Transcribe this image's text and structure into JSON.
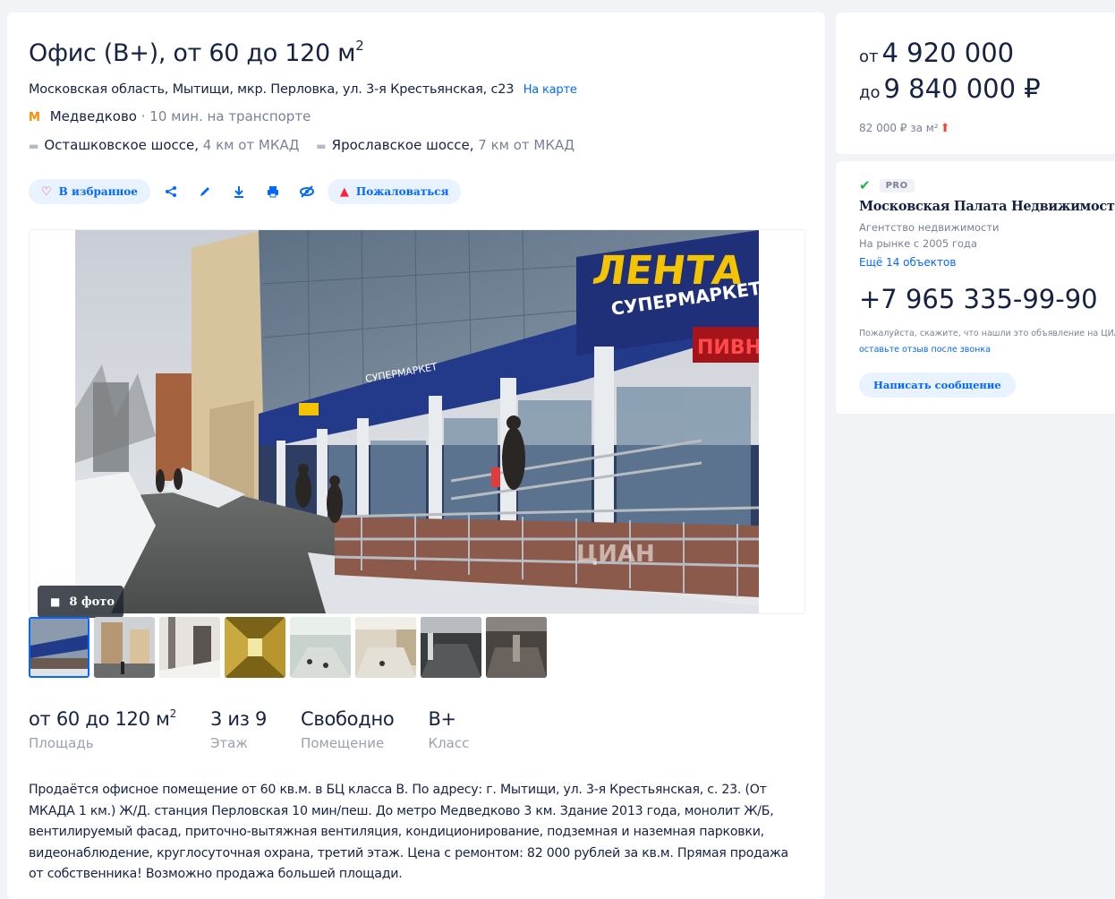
{
  "listing": {
    "title": "Офис (В+), от 60 до 120 м",
    "title_sup": "2",
    "address": "Московская область, Мытищи, мкр. Перловка, ул. 3-я Крестьянская, с23",
    "map_link": "На карте",
    "metro": {
      "icon": "metro-m-icon",
      "station": "Медведково",
      "time": "· 10 мин. на транспорте"
    },
    "highways": [
      {
        "name": "Осташковское шоссе,",
        "dist": "4 км от МКАД"
      },
      {
        "name": "Ярославское шоссе,",
        "dist": "7 км от МКАД"
      }
    ]
  },
  "actions": {
    "favorite": "В избранное",
    "report": "Пожаловаться",
    "icons": [
      "share-icon",
      "edit-icon",
      "download-icon",
      "print-icon",
      "hide-icon"
    ]
  },
  "gallery": {
    "photo_count": "8 фото",
    "watermark": "ЦИАН",
    "signs": {
      "store": "ЛЕНТА",
      "supermarket": "СУПЕРМАРКЕТ",
      "beer": "ПИВН"
    },
    "thumbnails": 8
  },
  "facts": [
    {
      "value": "от 60 до 120 м",
      "sup": "2",
      "label": "Площадь"
    },
    {
      "value": "3 из 9",
      "sup": "",
      "label": "Этаж"
    },
    {
      "value": "Свободно",
      "sup": "",
      "label": "Помещение"
    },
    {
      "value": "B+",
      "sup": "",
      "label": "Класс"
    }
  ],
  "description": "Продаётся офисное помещение от 60 кв.м. в БЦ класса В. По адресу: г. Мытищи, ул. 3-я Крестьянская, с. 23. (От МКАДА 1 км.) Ж/Д. станция Перловская 10 мин/пеш. До метро Медведково 3 км. Здание 2013 года, монолит Ж/Б, вентилируемый фасад, приточно-вытяжная вентиляция, кондиционирование, подземная и наземная парковки, видеонаблюдение, круглосуточная охрана, третий этаж. Цена с ремонтом: 82 000 рублей за кв.м. Прямая продажа от собственника! Возможно продажа большей площади.",
  "price": {
    "from_prefix": "от",
    "from": "4 920 000",
    "to_prefix": "до",
    "to": "9 840 000 ₽",
    "per_m": "82 000 ₽ за м²"
  },
  "agent": {
    "badge": "PRO",
    "name": "Московская Палата Недвижимости",
    "type": "Агентство недвижимости",
    "since": "На рынке с 2005 года",
    "more": "Ещё 14 объектов",
    "phone": "+7 965 335-99-90",
    "hint_prefix": "Пожалуйста, скажите, что нашли это объявление на ЦИАН. И ",
    "hint_link": "оставьте отзыв после звонка",
    "message_button": "Написать сообщение"
  },
  "colors": {
    "accent": "#0468ff",
    "text": "#152242",
    "muted": "#7a8197",
    "metro": "#ff8a00",
    "pro_green": "#1bb33d"
  }
}
